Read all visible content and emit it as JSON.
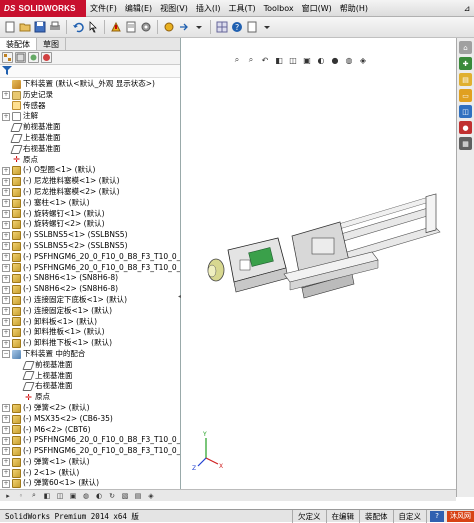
{
  "menubar": {
    "logo": "SOLIDWORKS",
    "items": [
      "文件(F)",
      "编辑(E)",
      "视图(V)",
      "插入(I)",
      "工具(T)",
      "Toolbox",
      "窗口(W)",
      "帮助(H)"
    ],
    "pin": "⊿"
  },
  "toolbar": {
    "buttons": [
      "new-icon",
      "open-icon",
      "save-icon",
      "print-icon",
      "undo-icon",
      "select-icon",
      "rebuild-icon",
      "options-icon"
    ]
  },
  "left": {
    "tabs": [
      "装配体",
      "草图"
    ],
    "active_tab": "装配体",
    "tree": [
      {
        "label": "下料装置  (默认<默认_外观 显示状态>)",
        "icon": "asm",
        "exp": "",
        "indent": 1
      },
      {
        "label": "历史记录",
        "icon": "folder",
        "exp": "+",
        "indent": 1
      },
      {
        "label": "传感器",
        "icon": "sensor",
        "exp": "",
        "indent": 1
      },
      {
        "label": "注解",
        "icon": "note",
        "exp": "+",
        "indent": 1
      },
      {
        "label": "前视基准面",
        "icon": "plane",
        "exp": "",
        "indent": 1
      },
      {
        "label": "上视基准面",
        "icon": "plane",
        "exp": "",
        "indent": 1
      },
      {
        "label": "右视基准面",
        "icon": "plane",
        "exp": "",
        "indent": 1
      },
      {
        "label": "原点",
        "icon": "origin",
        "exp": "",
        "indent": 1
      },
      {
        "label": "(-) O型圈<1> (默认)",
        "icon": "part",
        "exp": "+",
        "indent": 1
      },
      {
        "label": "(-) 尼龙推料塞模<1> (默认)",
        "icon": "part",
        "exp": "+",
        "indent": 1
      },
      {
        "label": "(-) 尼龙推料塞模<2> (默认)",
        "icon": "part",
        "exp": "+",
        "indent": 1
      },
      {
        "label": "(-) 塞柱<1> (默认)",
        "icon": "part",
        "exp": "+",
        "indent": 1
      },
      {
        "label": "(-) 旋转螺钉<1> (默认)",
        "icon": "part",
        "exp": "+",
        "indent": 1
      },
      {
        "label": "(-) 旋转螺钉<2> (默认)",
        "icon": "part",
        "exp": "+",
        "indent": 1
      },
      {
        "label": "(-) SSLBNS5<1> (SSLBNS5)",
        "icon": "part",
        "exp": "+",
        "indent": 1
      },
      {
        "label": "(-) SSLBNS5<2> (SSLBNS5)",
        "icon": "part",
        "exp": "+",
        "indent": 1
      },
      {
        "label": "(-) PSFHNGM6_20_0_F10_0_B8_F3_T10_0_S8_(",
        "icon": "part",
        "exp": "+",
        "indent": 1
      },
      {
        "label": "(-) PSFHNGM6_20_0_F10_0_B8_F3_T10_0_S8_(",
        "icon": "part",
        "exp": "+",
        "indent": 1
      },
      {
        "label": "(-) SN8H6<1> (SN8H6-8)",
        "icon": "part",
        "exp": "+",
        "indent": 1
      },
      {
        "label": "(-) SN8H6<2> (SN8H6-8)",
        "icon": "part",
        "exp": "+",
        "indent": 1
      },
      {
        "label": "(-) 连接固定下底板<1> (默认)",
        "icon": "part",
        "exp": "+",
        "indent": 1
      },
      {
        "label": "(-) 连接固定板<1> (默认)",
        "icon": "part",
        "exp": "+",
        "indent": 1
      },
      {
        "label": "(-) 卸料板<1> (默认)",
        "icon": "part",
        "exp": "+",
        "indent": 1
      },
      {
        "label": "(-) 卸料推板<1> (默认)",
        "icon": "part",
        "exp": "+",
        "indent": 1
      },
      {
        "label": "(-) 卸料推下板<1> (默认)",
        "icon": "part",
        "exp": "+",
        "indent": 1
      },
      {
        "label": "下料装置 中的配合",
        "icon": "mate",
        "exp": "−",
        "indent": 1
      },
      {
        "label": "前视基准面",
        "icon": "plane",
        "exp": "",
        "indent": 2
      },
      {
        "label": "上视基准面",
        "icon": "plane",
        "exp": "",
        "indent": 2
      },
      {
        "label": "右视基准面",
        "icon": "plane",
        "exp": "",
        "indent": 2
      },
      {
        "label": "原点",
        "icon": "origin",
        "exp": "",
        "indent": 2
      },
      {
        "label": "(-) 弹簧<2> (默认)",
        "icon": "part",
        "exp": "+",
        "indent": 1
      },
      {
        "label": "(-) MSX35<2> (CB6-35)",
        "icon": "part",
        "exp": "+",
        "indent": 1
      },
      {
        "label": "(-) M6<2> (CBT6)",
        "icon": "part",
        "exp": "+",
        "indent": 1
      },
      {
        "label": "(-) PSFHNGM6_20_0_F10_0_B8_F3_T10_0_S8_(",
        "icon": "part",
        "exp": "+",
        "indent": 1
      },
      {
        "label": "(-) PSFHNGM6_20_0_F10_0_B8_F3_T10_0_S8_(",
        "icon": "part",
        "exp": "+",
        "indent": 1
      },
      {
        "label": "(-) 弹簧<1> (默认)",
        "icon": "part",
        "exp": "+",
        "indent": 1
      },
      {
        "label": "(-) 2<1> (默认)",
        "icon": "part",
        "exp": "+",
        "indent": 1
      },
      {
        "label": "(-) 弹簧60<1> (默认)",
        "icon": "part",
        "exp": "+",
        "indent": 1
      }
    ]
  },
  "status": {
    "app": "SolidWorks Premium 2014 x64 版",
    "cells": [
      "欠定义",
      "在编辑",
      "装配体",
      "自定义"
    ],
    "help": "?",
    "watermark": "沐风网"
  },
  "colors": {
    "brand": "#c8102e",
    "model_frame": "#c0c0c0",
    "model_green": "#3aa04a",
    "axis_x": "#d02020",
    "axis_y": "#20a020",
    "axis_z": "#2040d0"
  }
}
